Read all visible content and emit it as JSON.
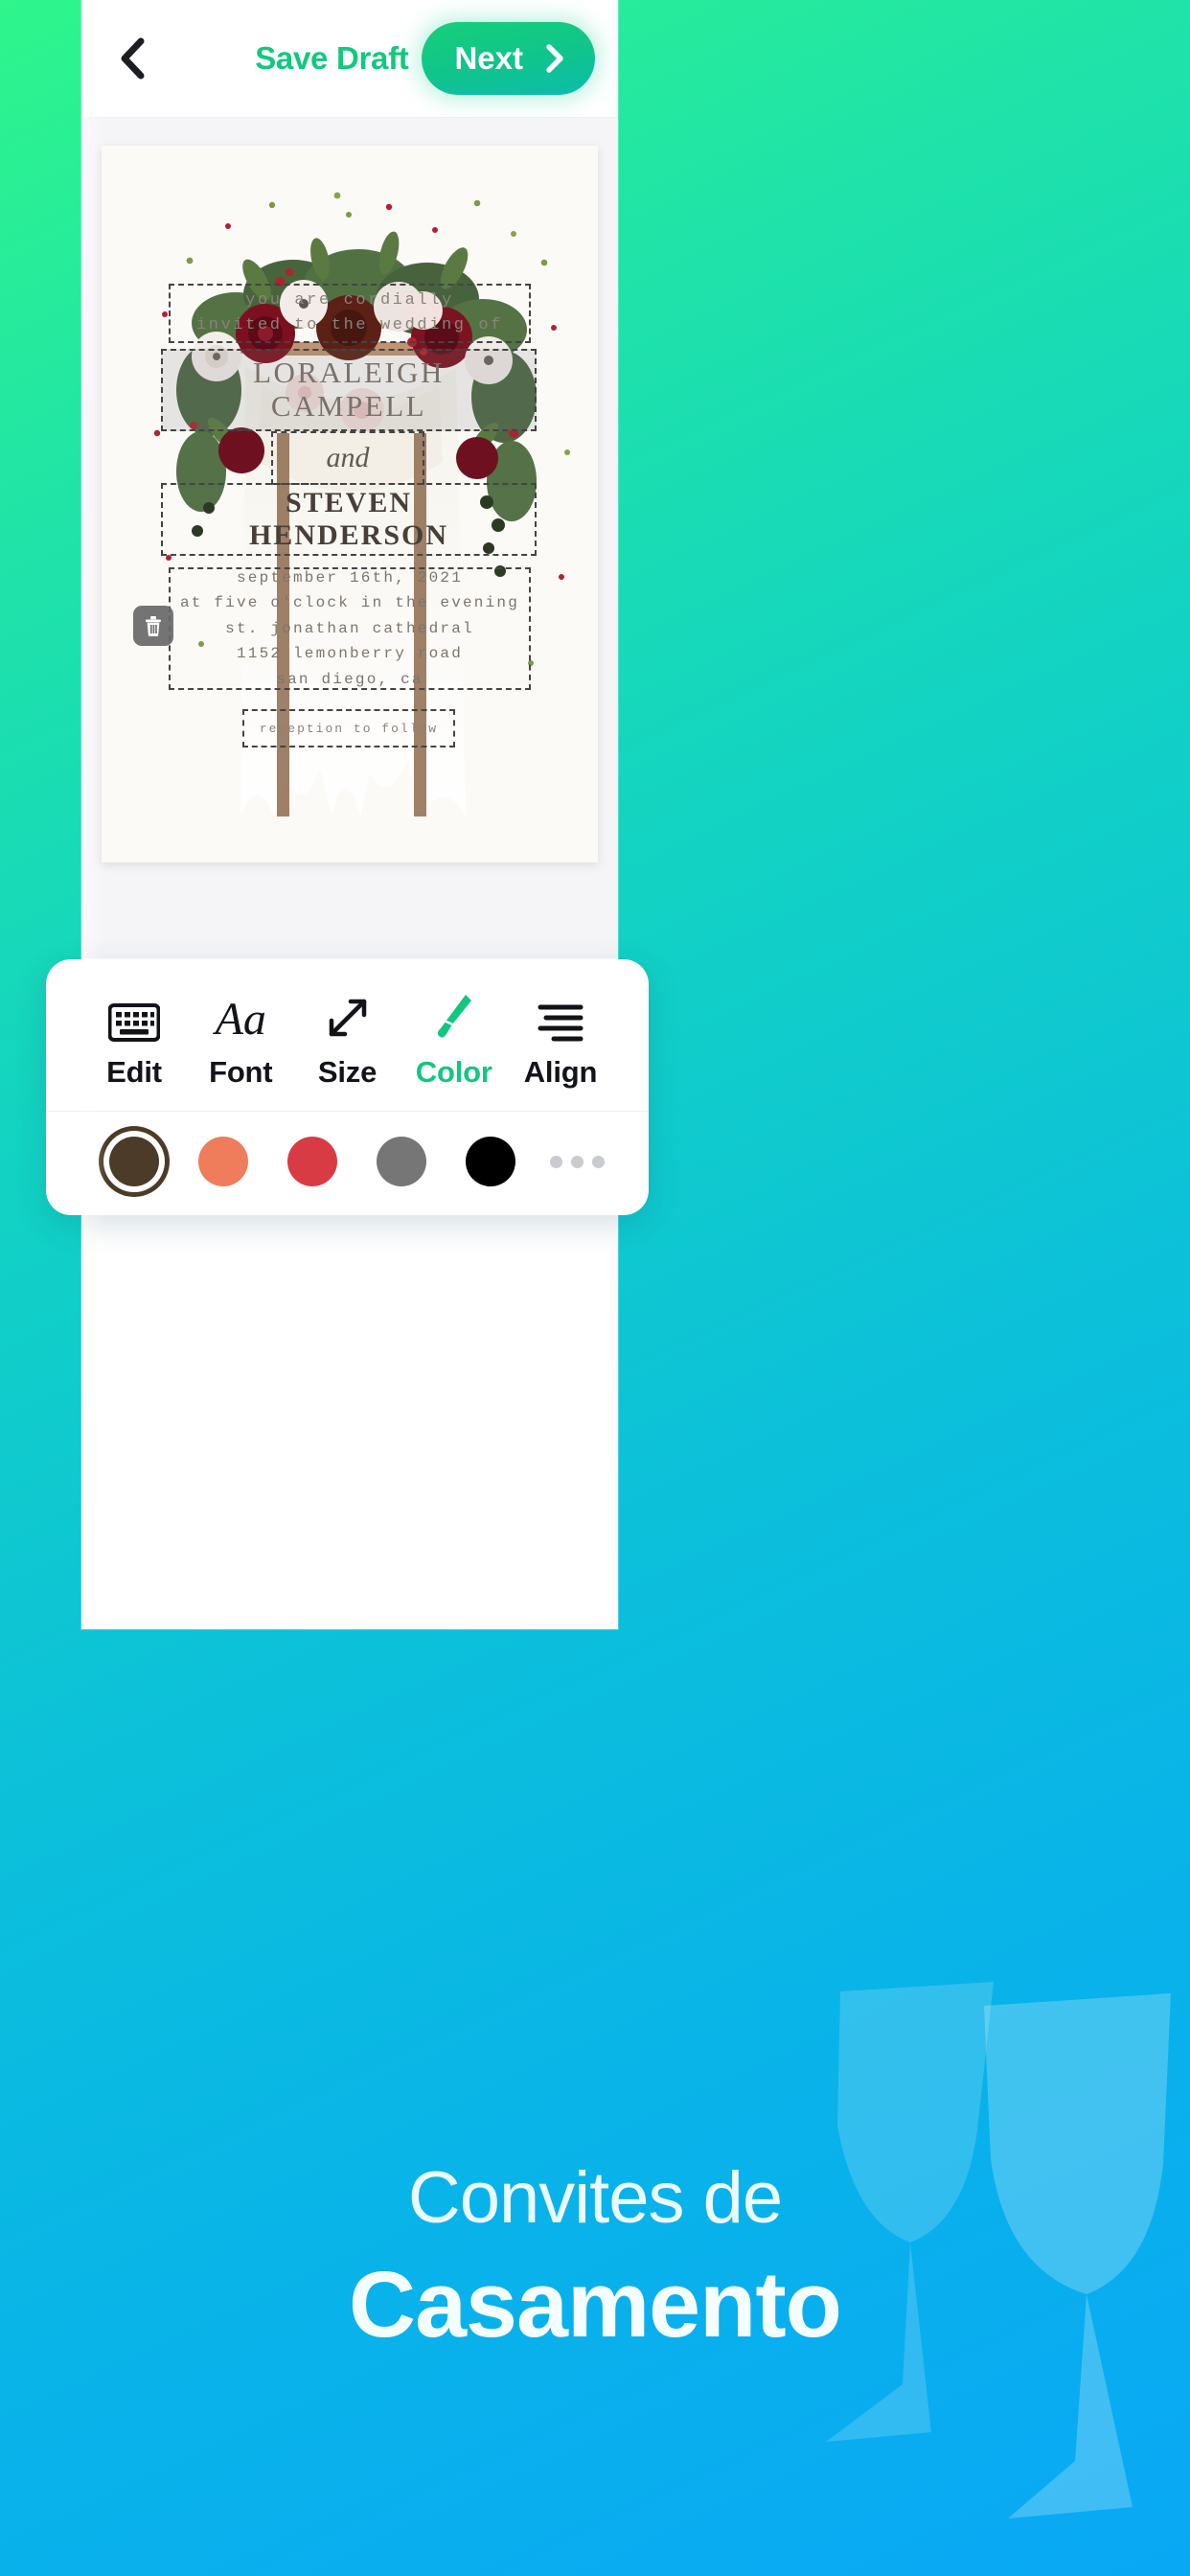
{
  "header": {
    "back_icon": "chevron-left-icon",
    "save_draft_label": "Save Draft",
    "next_label": "Next",
    "next_icon": "chevron-right-icon"
  },
  "canvas": {
    "delete_icon": "trash-icon",
    "text_blocks": [
      {
        "name": "intro",
        "lines": [
          "you are cordially",
          "invited to the wedding of"
        ]
      },
      {
        "name": "bride-name",
        "lines": [
          "LORALEIGH",
          "CAMPELL"
        ],
        "selected": true
      },
      {
        "name": "conjunction",
        "lines": [
          "and"
        ]
      },
      {
        "name": "groom-name",
        "lines": [
          "STEVEN",
          "HENDERSON"
        ]
      },
      {
        "name": "details",
        "lines": [
          "september 16th, 2021",
          "at five o'clock in the evening",
          "st. jonathan cathedral",
          "1152 lemonberry road",
          "san diego, ca"
        ]
      },
      {
        "name": "reception",
        "lines": [
          "reception to follow"
        ]
      }
    ]
  },
  "toolbar": {
    "active_tool": "Color",
    "tools": [
      {
        "label": "Edit",
        "icon": "keyboard-icon"
      },
      {
        "label": "Font",
        "icon": "aa-typeface-icon"
      },
      {
        "label": "Size",
        "icon": "resize-diagonal-arrows-icon"
      },
      {
        "label": "Color",
        "icon": "paintbrush-icon"
      },
      {
        "label": "Align",
        "icon": "align-lines-icon"
      }
    ],
    "swatches": [
      {
        "name": "dark-brown",
        "hex": "#4b3b28",
        "selected": true
      },
      {
        "name": "coral",
        "hex": "#ef7c5a",
        "selected": false
      },
      {
        "name": "red",
        "hex": "#d93b44",
        "selected": false
      },
      {
        "name": "gray",
        "hex": "#767676",
        "selected": false
      },
      {
        "name": "black",
        "hex": "#000000",
        "selected": false
      }
    ],
    "more_icon": "more-horizontal-icon"
  },
  "promo": {
    "line1": "Convites de",
    "line2": "Casamento"
  },
  "colors": {
    "accent_green": "#11c97e",
    "bg_gradient_start": "#2ff58c",
    "bg_gradient_end": "#09a8f5"
  }
}
